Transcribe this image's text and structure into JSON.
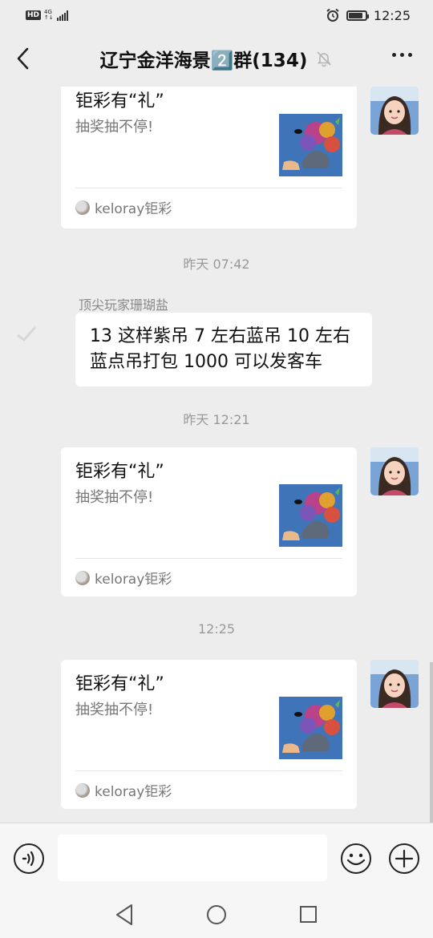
{
  "status_bar": {
    "hd": "HD",
    "network_top": "4G",
    "network_bottom": "↑↓",
    "time": "12:25",
    "battery_level": 0.85
  },
  "header": {
    "title": "辽宁金洋海景2️⃣群(134)"
  },
  "messages": [
    {
      "type": "card",
      "title": "钜彩有“礼”",
      "desc": "抽奖抽不停!",
      "source": "keloray钜彩"
    },
    {
      "type": "timestamp",
      "text": "昨天 07:42"
    },
    {
      "type": "text",
      "sender": "顶尖玩家珊瑚盐",
      "text": "13 这样紫吊 7 左右蓝吊 10 左右蓝点吊打包 1000 可以发客车"
    },
    {
      "type": "timestamp",
      "text": "昨天 12:21"
    },
    {
      "type": "card",
      "title": "钜彩有“礼”",
      "desc": "抽奖抽不停!",
      "source": "keloray钜彩"
    },
    {
      "type": "timestamp",
      "text": "12:25"
    },
    {
      "type": "card",
      "title": "钜彩有“礼”",
      "desc": "抽奖抽不停!",
      "source": "keloray钜彩"
    }
  ],
  "input": {
    "value": "",
    "placeholder": ""
  },
  "icons": {
    "back": "chevron-left-icon",
    "mute": "bell-off-icon",
    "more": "more-dots-icon",
    "voice": "voice-icon",
    "emoji": "smiley-icon",
    "plus": "plus-circle-icon",
    "source": "keloray-logo-icon"
  }
}
